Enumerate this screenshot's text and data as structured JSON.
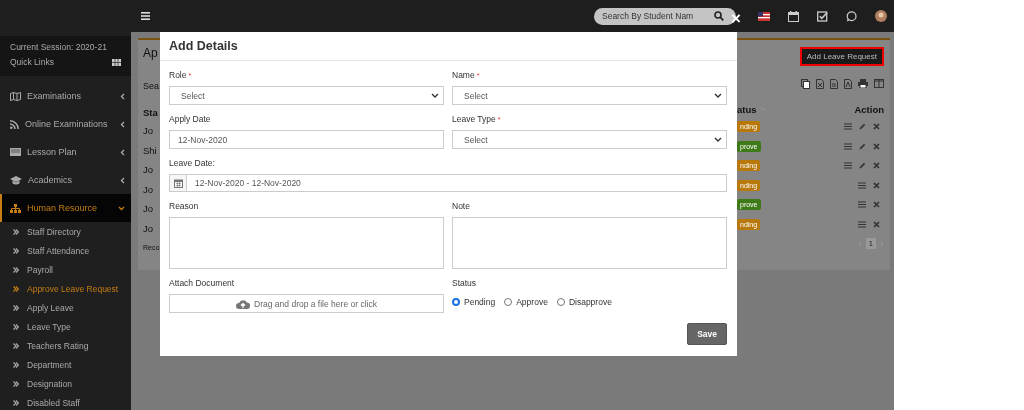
{
  "topbar": {
    "search": {
      "placeholder": "Search By Student Nam"
    }
  },
  "sidebar": {
    "session": "Current Session: 2020-21",
    "quick_links": "Quick Links",
    "items": [
      {
        "label": "Examinations",
        "expanded": false,
        "selected": false
      },
      {
        "label": "Online Examinations",
        "expanded": false,
        "selected": false
      },
      {
        "label": "Lesson Plan",
        "expanded": false,
        "selected": false
      },
      {
        "label": "Academics",
        "expanded": false,
        "selected": false
      },
      {
        "label": "Human Resource",
        "expanded": true,
        "selected": true,
        "children": [
          {
            "label": "Staff Directory",
            "selected": false
          },
          {
            "label": "Staff Attendance",
            "selected": false
          },
          {
            "label": "Payroll",
            "selected": false
          },
          {
            "label": "Approve Leave Request",
            "selected": true
          },
          {
            "label": "Apply Leave",
            "selected": false
          },
          {
            "label": "Leave Type",
            "selected": false
          },
          {
            "label": "Teachers Rating",
            "selected": false
          },
          {
            "label": "Department",
            "selected": false
          },
          {
            "label": "Designation",
            "selected": false
          },
          {
            "label": "Disabled Staff",
            "selected": false
          }
        ]
      }
    ]
  },
  "page": {
    "title": "Ap",
    "search_label": "Sea",
    "add_button": "Add Leave Request",
    "column_1": "Sta",
    "status_header": "atus",
    "action_header": "Action",
    "rows": [
      {
        "name": "Jo",
        "status": "nding",
        "color": "#b8780a",
        "editable": true
      },
      {
        "name": "Shi",
        "status": "prove",
        "color": "#3f7a18",
        "editable": true
      },
      {
        "name": "Jo",
        "status": "nding",
        "color": "#b8780a",
        "editable": true
      },
      {
        "name": "Jo",
        "status": "nding",
        "color": "#b8780a",
        "editable": false
      },
      {
        "name": "Jo",
        "status": "prove",
        "color": "#3f7a18",
        "editable": false
      },
      {
        "name": "Jo",
        "status": "nding",
        "color": "#b8780a",
        "editable": false
      }
    ],
    "footer": "Reco",
    "pagination": {
      "page": "1"
    }
  },
  "modal": {
    "title": "Add Details",
    "close": "×",
    "fields": [
      {
        "kind": "select",
        "label": "Role",
        "required_mark": "*",
        "value": "Select"
      },
      {
        "kind": "select",
        "label": "Name",
        "required_mark": "*",
        "value": "Select"
      },
      {
        "kind": "text",
        "label": "Apply Date",
        "value": "12-Nov-2020"
      },
      {
        "kind": "select",
        "label": "Leave Type",
        "required_mark": "*",
        "value": "Select"
      },
      {
        "kind": "daterange",
        "label": "Leave Date:",
        "value": "12-Nov-2020 - 12-Nov-2020"
      },
      {
        "kind": "textarea",
        "label": "Reason"
      },
      {
        "kind": "textarea",
        "label": "Note"
      },
      {
        "kind": "file",
        "label": "Attach Document",
        "value": "Drag and drop a file here or click"
      },
      {
        "kind": "radio",
        "label": "Status",
        "options": [
          {
            "label": "Pending",
            "selected": true
          },
          {
            "label": "Approve",
            "selected": false
          },
          {
            "label": "Disapprove",
            "selected": false
          }
        ]
      }
    ],
    "save_button": "Save"
  }
}
